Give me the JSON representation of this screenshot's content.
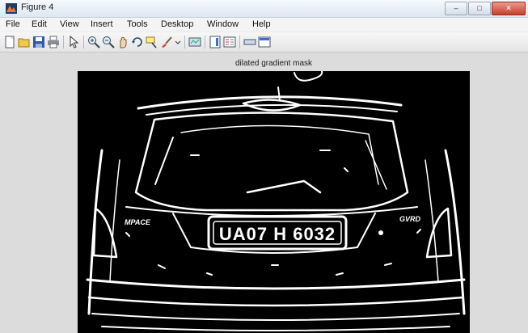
{
  "window": {
    "title": "Figure 4",
    "controls": {
      "minimize": "–",
      "maximize": "□",
      "close": "✕"
    }
  },
  "menu": [
    "File",
    "Edit",
    "View",
    "Insert",
    "Tools",
    "Desktop",
    "Window",
    "Help"
  ],
  "toolbar": {
    "icons": [
      "new-figure-icon",
      "open-file-icon",
      "save-icon",
      "print-icon",
      "edit-plot-arrow-icon",
      "zoom-in-icon",
      "zoom-out-icon",
      "pan-icon",
      "rotate-3d-icon",
      "data-cursor-icon",
      "brush-icon",
      "link-plot-icon",
      "insert-colorbar-icon",
      "insert-legend-icon",
      "hide-plot-tools-icon",
      "show-plot-tools-icon"
    ]
  },
  "axes": {
    "title": "dilated gradient mask",
    "plate_text": "UA07 H 6032",
    "badge_left": "MPACE",
    "badge_right": "GVRD"
  },
  "colors": {
    "background": "#000000",
    "foreground": "#ffffff"
  }
}
